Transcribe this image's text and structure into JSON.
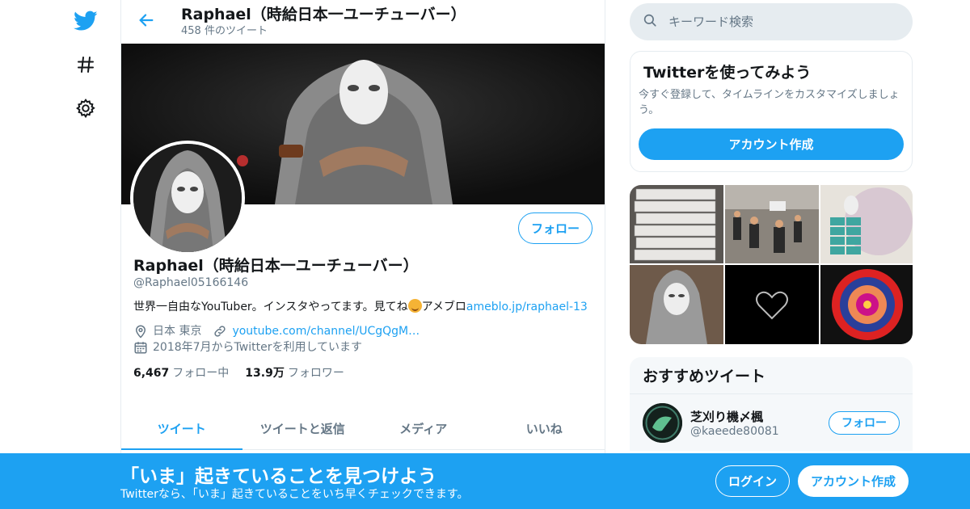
{
  "nav": {
    "items": [
      {
        "icon": "twitter-bird-icon"
      },
      {
        "icon": "hashtag-icon"
      },
      {
        "icon": "gear-icon"
      }
    ]
  },
  "header": {
    "title": "Raphael（時給日本一ユーチューバー）",
    "tweet_count": "458 件のツイート"
  },
  "profile": {
    "follow_label": "フォロー",
    "name": "Raphael（時給日本一ユーチューバー）",
    "handle": "@Raphael05166146",
    "bio_text": "世界一自由なYouTuber。インスタやってます。見てね",
    "bio_after_emoji": "アメブロ",
    "bio_link": "ameblo.jp/raphael-13",
    "location": "日本 東京",
    "website": "youtube.com/channel/UCgQgM…",
    "joined": "2018年7月からTwitterを利用しています",
    "following_count": "6,467",
    "following_label": "フォロー中",
    "followers_count": "13.9万",
    "followers_label": "フォロワー"
  },
  "tabs": [
    {
      "label": "ツイート",
      "active": true
    },
    {
      "label": "ツイートと返信"
    },
    {
      "label": "メディア"
    },
    {
      "label": "いいね"
    }
  ],
  "search": {
    "placeholder": "キーワード検索"
  },
  "signup_card": {
    "title": "Twitterを使ってみよう",
    "text": "今すぐ登録して、タイムラインをカスタマイズしましょう。",
    "button": "アカウント作成"
  },
  "recommend": {
    "title": "おすすめツイート",
    "user": {
      "name": "芝刈り機〆楓",
      "handle": "@kaeede80081",
      "follow_label": "フォロー"
    }
  },
  "bottom_bar": {
    "title": "「いま」起きていることを見つけよう",
    "subtitle": "Twitterなら、「いま」起きていることをいち早くチェックできます。",
    "login": "ログイン",
    "signup": "アカウント作成"
  },
  "colors": {
    "accent": "#1da1f2",
    "border": "#e6ecf0",
    "secondary_text": "#657786"
  }
}
